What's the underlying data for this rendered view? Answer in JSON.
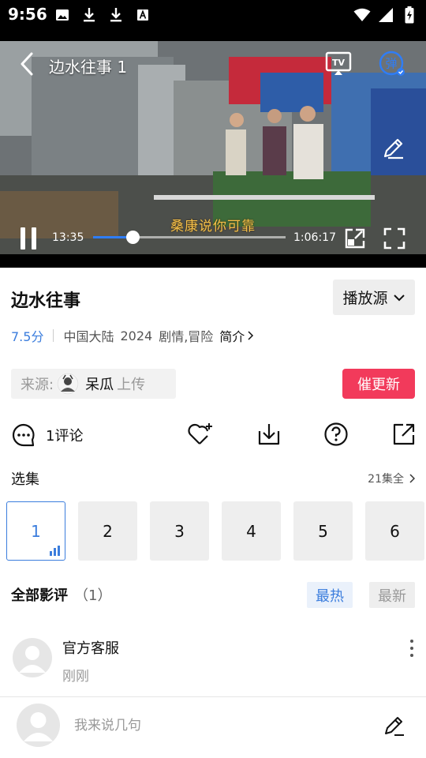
{
  "status_bar": {
    "time": "9:56",
    "left_icons": [
      "image-icon",
      "download-icon",
      "download-icon",
      "font-icon"
    ],
    "right_icons": [
      "wifi-icon",
      "signal-icon",
      "battery-charging-icon"
    ]
  },
  "player": {
    "title": "边水往事 1",
    "subtitle": "桑康说你可靠",
    "current_time": "13:35",
    "total_time": "1:06:17",
    "progress_fraction": 0.205,
    "tv_label": "TV",
    "danmu_label": "弹",
    "accent_color": "#2f7df6"
  },
  "show": {
    "title": "边水往事",
    "source_select_label": "播放源",
    "rating": "7.5分",
    "region": "中国大陆",
    "year": "2024",
    "genres": "剧情,冒险",
    "intro_label": "简介"
  },
  "uploader": {
    "label": "来源:",
    "name": "呆瓜",
    "action": "上传",
    "urge_label": "催更新",
    "urge_color": "#f23a5b"
  },
  "actions": {
    "comment_count_label": "1评论",
    "icons": [
      "favorite-add-icon",
      "download-icon",
      "help-icon",
      "share-icon"
    ]
  },
  "episodes": {
    "label": "选集",
    "all_label": "21集全",
    "items": [
      {
        "number": "1",
        "active": true
      },
      {
        "number": "2",
        "active": false
      },
      {
        "number": "3",
        "active": false
      },
      {
        "number": "4",
        "active": false
      },
      {
        "number": "5",
        "active": false
      },
      {
        "number": "6",
        "active": false
      }
    ]
  },
  "reviews": {
    "title": "全部影评",
    "count": "（1）",
    "sort_hot": "最热",
    "sort_new": "最新",
    "items": [
      {
        "author": "官方客服",
        "time": "刚刚"
      }
    ]
  },
  "composer": {
    "placeholder": "我来说几句"
  }
}
